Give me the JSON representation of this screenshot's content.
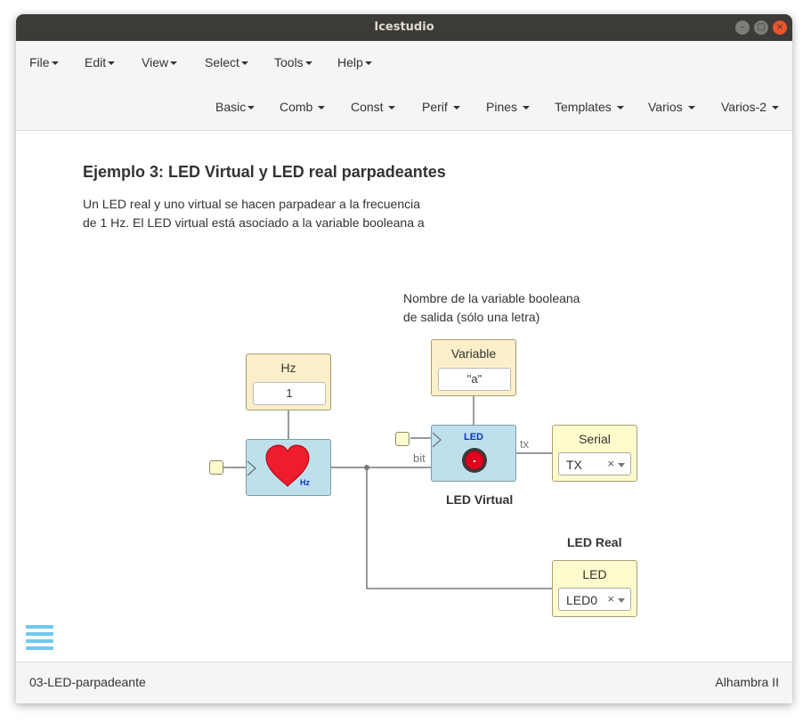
{
  "window": {
    "title": "Icestudio"
  },
  "menu": {
    "top": [
      "File",
      "Edit",
      "View",
      "Select",
      "Tools",
      "Help"
    ],
    "collections": [
      "Basic",
      "Comb",
      "Const",
      "Perif",
      "Pines",
      "Templates",
      "Varios",
      "Varios-2"
    ]
  },
  "canvas": {
    "heading": "Ejemplo 3: LED Virtual y LED real parpadeantes",
    "paragraph_line1": "Un LED real y uno virtual se hacen parpadear a la frecuencia",
    "paragraph_line2": "de 1 Hz. El LED virtual está asociado a la variable booleana a",
    "note_line1": "Nombre de la variable booleana",
    "note_line2": "de salida (sólo una letra)",
    "hz_block": {
      "label": "Hz",
      "value": "1"
    },
    "heart_block": {
      "unit": "Hz"
    },
    "variable_block": {
      "label": "Variable",
      "value": "\"a\""
    },
    "led_virtual_block": {
      "title": "LED",
      "caption": "LED Virtual"
    },
    "wire_labels": {
      "bit": "bit",
      "tx": "tx"
    },
    "serial_block": {
      "label": "Serial",
      "selected": "TX",
      "clear": "×"
    },
    "led_real_caption": "LED Real",
    "led_block": {
      "label": "LED",
      "selected": "LED0",
      "clear": "×"
    },
    "colors": {
      "heart": "#ee1c2c",
      "led_red": "#e3001c",
      "led_title": "#0a33c7",
      "menu_icon": "#6fc8f0"
    }
  },
  "status": {
    "project": "03-LED-parpadeante",
    "board": "Alhambra II"
  }
}
